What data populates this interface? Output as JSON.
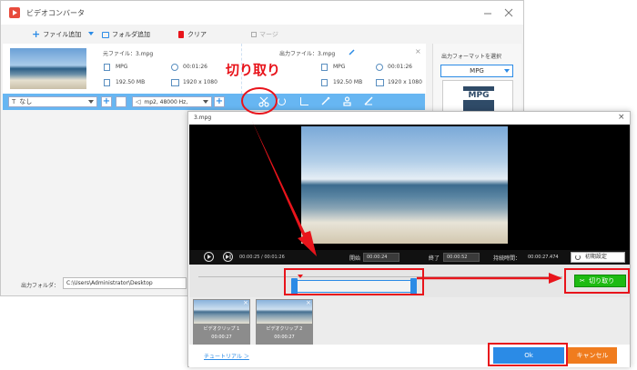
{
  "main_window": {
    "title": "ビデオコンバータ",
    "toolbar": {
      "add_file": "ファイル追加",
      "add_folder": "フォルダ追加",
      "clear": "クリア",
      "merge": "マージ"
    },
    "source": {
      "label": "元ファイル：",
      "filename": "3.mpg",
      "format": "MPG",
      "duration": "00:01:26",
      "size": "192.50 MB",
      "resolution": "1920 x 1080"
    },
    "output": {
      "label": "出力ファイル：",
      "filename": "3.mpg",
      "format": "MPG",
      "duration": "00:01:26",
      "size": "192.50 MB",
      "resolution": "1920 x 1080"
    },
    "subtitle_select": "なし",
    "audio_select": "mp2, 48000 Hz,",
    "output_format_panel": {
      "title": "出力フォーマットを選択",
      "format": "MPG",
      "badge": "MPG"
    },
    "output_folder": {
      "label": "出力フォルダ：",
      "path": "C:\\Users\\Administrator\\Desktop"
    }
  },
  "annotation": {
    "cut_label": "切り取り"
  },
  "trim_dialog": {
    "title": "3.mpg",
    "time_display": "00:00:25 / 00:01:26",
    "start_label": "開始",
    "start_value": "00:00:24",
    "end_label": "終了",
    "end_value": "00:00:52",
    "duration_label": "持続時間：",
    "duration_value": "00:00:27.474",
    "reset_label": "初期設定",
    "cut_button": "切り取り",
    "clips": [
      {
        "name": "ビデオクリップ 1",
        "duration": "00:00:27"
      },
      {
        "name": "ビデオクリップ 2",
        "duration": "00:00:27"
      }
    ],
    "tutorial_link": "チュートリアル ＞",
    "ok_button": "Ok",
    "cancel_button": "キャンセル"
  },
  "colors": {
    "accent_blue": "#2b8be6",
    "highlight_red": "#e8141b",
    "cut_green": "#1ebb12",
    "cancel_orange": "#f07c1e",
    "icon_toolbar_blue": "#4ba6ec"
  }
}
